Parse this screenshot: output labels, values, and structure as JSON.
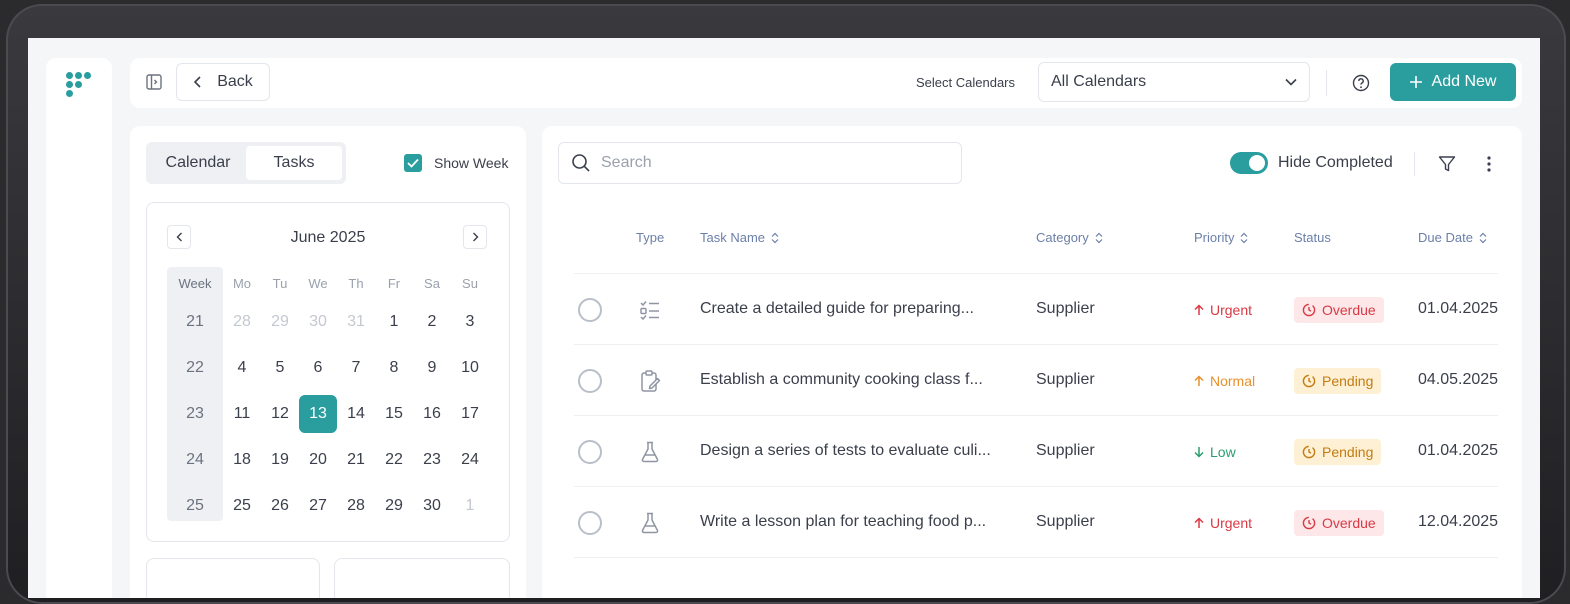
{
  "topbar": {
    "back_label": "Back",
    "select_label": "Select Calendars",
    "select_value": "All Calendars",
    "add_label": "Add New"
  },
  "left": {
    "tab_calendar": "Calendar",
    "tab_tasks": "Tasks",
    "show_week_label": "Show Week",
    "month_title": "June 2025",
    "header": [
      "Week",
      "Mo",
      "Tu",
      "We",
      "Th",
      "Fr",
      "Sa",
      "Su"
    ],
    "weeks": [
      {
        "week": "21",
        "days": [
          "28",
          "29",
          "30",
          "31",
          "1",
          "2",
          "3"
        ]
      },
      {
        "week": "22",
        "days": [
          "4",
          "5",
          "6",
          "7",
          "8",
          "9",
          "10"
        ]
      },
      {
        "week": "23",
        "days": [
          "11",
          "12",
          "13",
          "14",
          "15",
          "16",
          "17"
        ]
      },
      {
        "week": "24",
        "days": [
          "18",
          "19",
          "20",
          "21",
          "22",
          "23",
          "24"
        ]
      },
      {
        "week": "25",
        "days": [
          "25",
          "26",
          "27",
          "28",
          "29",
          "30",
          "1"
        ]
      }
    ],
    "selected_day": "13"
  },
  "right": {
    "search_placeholder": "Search",
    "hide_completed_label": "Hide Completed",
    "columns": {
      "type": "Type",
      "task_name": "Task Name",
      "category": "Category",
      "priority": "Priority",
      "status": "Status",
      "due_date": "Due Date"
    },
    "rows": [
      {
        "icon": "checklist-icon",
        "name": "Create a detailed guide for preparing...",
        "category": "Supplier",
        "priority": "Urgent",
        "status": "Overdue",
        "due": "01.04.2025"
      },
      {
        "icon": "clipboard-edit-icon",
        "name": "Establish a community cooking class f...",
        "category": "Supplier",
        "priority": "Normal",
        "status": "Pending",
        "due": "04.05.2025"
      },
      {
        "icon": "flask-icon",
        "name": "Design a series of tests to evaluate culi...",
        "category": "Supplier",
        "priority": "Low",
        "status": "Pending",
        "due": "01.04.2025"
      },
      {
        "icon": "flask-icon",
        "name": "Write a lesson plan for teaching food p...",
        "category": "Supplier",
        "priority": "Urgent",
        "status": "Overdue",
        "due": "12.04.2025"
      }
    ]
  },
  "colors": {
    "accent": "#2a9d9f",
    "urgent": "#d93a44",
    "normal": "#e8912b",
    "low": "#2a9d6f",
    "overdue_bg": "#fde7e9",
    "pending_bg": "#fdf0d5"
  }
}
